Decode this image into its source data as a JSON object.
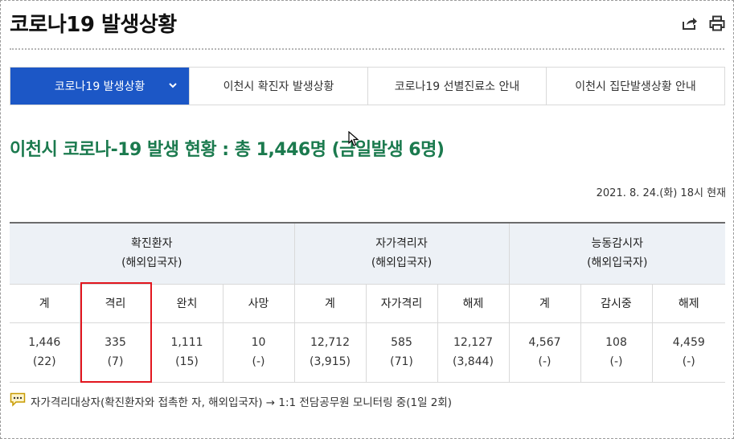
{
  "page": {
    "title": "코로나19 발생상황",
    "share_icon": "share-icon",
    "print_icon": "print-icon"
  },
  "tabs": [
    {
      "label": "코로나19 발생상황",
      "active": true
    },
    {
      "label": "이천시 확진자 발생상황",
      "active": false
    },
    {
      "label": "코로나19 선별진료소 안내",
      "active": false
    },
    {
      "label": "이천시 집단발생상황 안내",
      "active": false
    }
  ],
  "headline": "이천시 코로나-19 발생 현황 : 총 1,446명 (금일발생 6명)",
  "as_of": "2021. 8. 24.(화) 18시 현재",
  "table": {
    "groups": [
      {
        "name": "확진환자",
        "sub": "(해외입국자)"
      },
      {
        "name": "자가격리자",
        "sub": "(해외입국자)"
      },
      {
        "name": "능동감시자",
        "sub": "(해외입국자)"
      }
    ],
    "columns": [
      "계",
      "격리",
      "완치",
      "사망",
      "계",
      "자가격리",
      "해제",
      "계",
      "감시중",
      "해제"
    ],
    "values": [
      {
        "main": "1,446",
        "sub": "(22)"
      },
      {
        "main": "335",
        "sub": "(7)"
      },
      {
        "main": "1,111",
        "sub": "(15)"
      },
      {
        "main": "10",
        "sub": "(-)"
      },
      {
        "main": "12,712",
        "sub": "(3,915)"
      },
      {
        "main": "585",
        "sub": "(71)"
      },
      {
        "main": "12,127",
        "sub": "(3,844)"
      },
      {
        "main": "4,567",
        "sub": "(-)"
      },
      {
        "main": "108",
        "sub": "(-)"
      },
      {
        "main": "4,459",
        "sub": "(-)"
      }
    ]
  },
  "note": {
    "icon": "speech-bubble-icon",
    "text": "자가격리대상자(확진환자와 접촉한 자, 해외입국자) → 1:1 전담공무원 모니터링 중(1일 2회)"
  },
  "colors": {
    "tab_active": "#1c57c6",
    "headline": "#1b7a4e",
    "isolation": "#d8202c",
    "self_quarantine": "#2a9d8f",
    "monitoring": "#5432c4",
    "highlight_box": "#e2161f"
  }
}
